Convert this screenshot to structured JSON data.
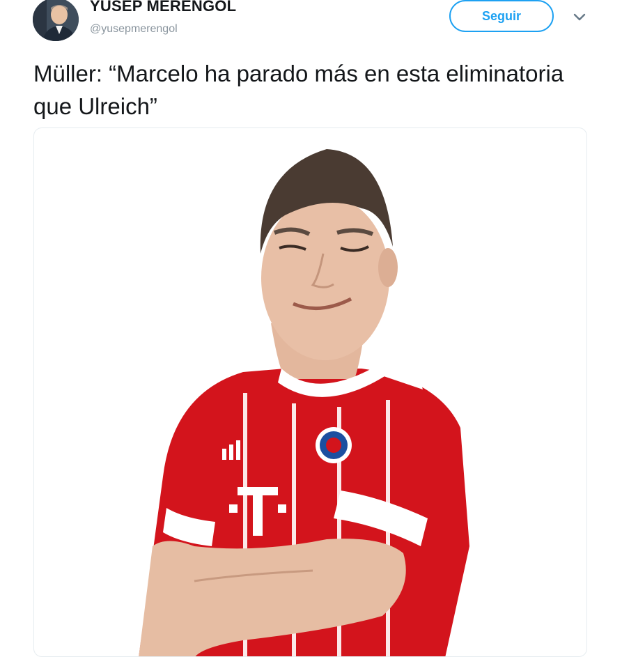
{
  "author": {
    "display_name": "YUSEP MERENGOL",
    "handle": "@yusepmerengol",
    "avatar_icon": "user-avatar"
  },
  "actions": {
    "follow_label": "Seguir",
    "menu_icon": "chevron-down-icon"
  },
  "tweet": {
    "text": "Müller: “Marcelo ha parado más en esta eliminatoria que Ulreich”"
  },
  "media": {
    "jersey_text": "T"
  },
  "colors": {
    "accent": "#1da1f2",
    "text": "#14171a",
    "muted": "#8a959e",
    "jersey_red": "#d3141c"
  }
}
